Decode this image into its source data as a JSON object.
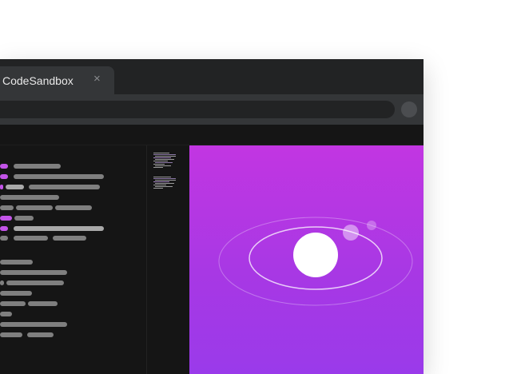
{
  "browser": {
    "tab_title": "CodeSandbox",
    "tab_close": "×"
  },
  "colors": {
    "purple_token": "#c354e8",
    "grey_token": "#7f7f7f",
    "preview_top": "#c236e2",
    "preview_bottom": "#9a3aea"
  },
  "icons": [
    "close-icon"
  ]
}
